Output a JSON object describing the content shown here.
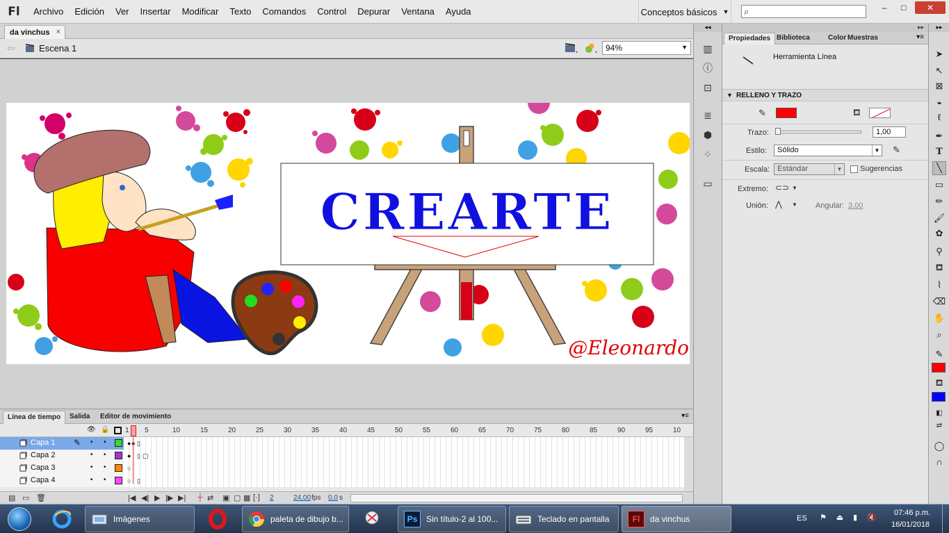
{
  "app": {
    "logo": "Fl",
    "menus": [
      "Archivo",
      "Edición",
      "Ver",
      "Insertar",
      "Modificar",
      "Texto",
      "Comandos",
      "Control",
      "Depurar",
      "Ventana",
      "Ayuda"
    ],
    "workspace": "Conceptos básicos",
    "window_buttons": {
      "minimize": "–",
      "maximize": "□",
      "close": "✕"
    }
  },
  "document": {
    "tab_label": "da vinchus",
    "tab_close": "×",
    "scene_label": "Escena 1",
    "zoom": "94%"
  },
  "stage": {
    "title_text": "CREARTE",
    "signature": "@Eleonardo",
    "colors": {
      "title": "#1010e0",
      "signature": "#e00000",
      "banner_border": "#333333"
    }
  },
  "timeline": {
    "tabs": [
      "Línea de tiempo",
      "Salida",
      "Editor de movimiento"
    ],
    "menu_icon": "▾≡",
    "frame_numbers": [
      "1",
      "5",
      "10",
      "15",
      "20",
      "25",
      "30",
      "35",
      "40",
      "45",
      "50",
      "55",
      "60",
      "65",
      "70",
      "75",
      "80",
      "85",
      "90",
      "95",
      "10"
    ],
    "layers": [
      {
        "name": "Capa 1",
        "color": "#33dd33",
        "selected": true
      },
      {
        "name": "Capa 2",
        "color": "#aa33cc",
        "selected": false
      },
      {
        "name": "Capa 3",
        "color": "#ff8800",
        "selected": false
      },
      {
        "name": "Capa 4",
        "color": "#ff44ff",
        "selected": false
      }
    ],
    "footer": {
      "current_frame": "2",
      "fps": "24,00",
      "fps_unit": "fps",
      "time": "0,0",
      "time_unit": "s"
    }
  },
  "properties": {
    "tabs": [
      "Propiedades",
      "Biblioteca",
      "Color",
      "Muestras"
    ],
    "tool_name": "Herramienta Línea",
    "section_fill_stroke": "RELLENO Y TRAZO",
    "stroke_color": "#ff0000",
    "labels": {
      "stroke": "Trazo:",
      "style": "Estilo:",
      "scale": "Escala:",
      "hints": "Sugerencias",
      "cap": "Extremo:",
      "join": "Unión:",
      "angular": "Angular:"
    },
    "stroke_value": "1,00",
    "style_value": "Sólido",
    "scale_value": "Estándar",
    "angular_value": "3,00"
  },
  "tools": {
    "stroke_color": "#ff0000",
    "fill_color": "#0000ff"
  },
  "taskbar": {
    "buttons": [
      {
        "label": "Imágenes",
        "icon": "explorer"
      },
      {
        "label": "paleta de dibujo b...",
        "icon": "chrome"
      },
      {
        "label": "Sin título-2 al 100...",
        "icon": "Ps"
      },
      {
        "label": "Teclado en pantalla",
        "icon": "keyboard"
      },
      {
        "label": "da vinchus",
        "icon": "Fl"
      }
    ],
    "language": "ES",
    "time": "07:46 p.m.",
    "date": "16/01/2018"
  }
}
